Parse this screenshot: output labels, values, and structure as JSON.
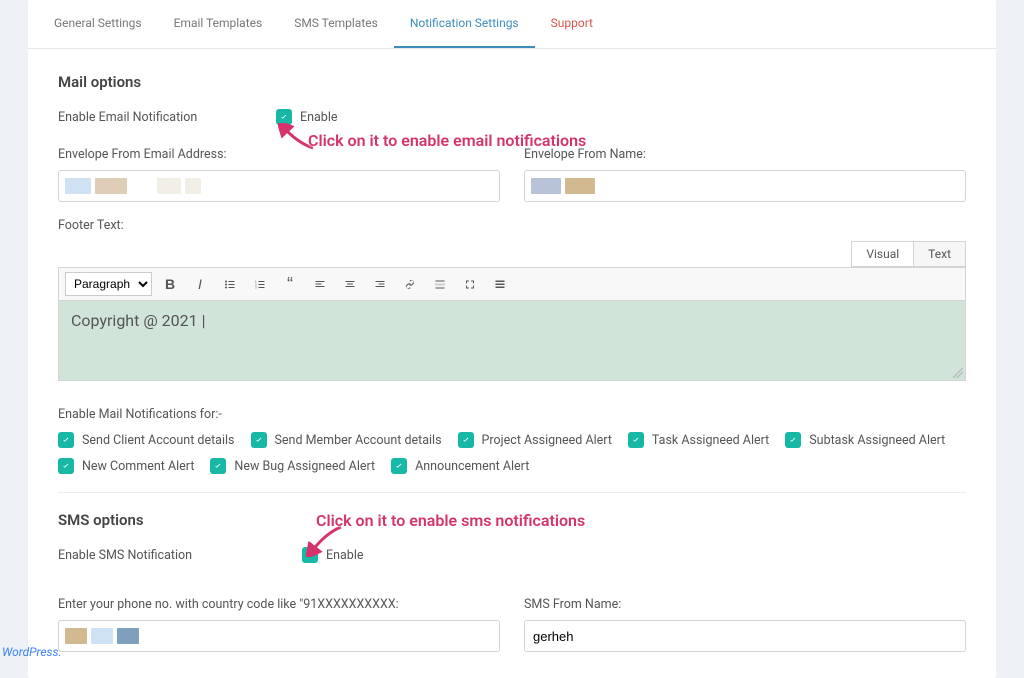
{
  "tabs": {
    "general": "General Settings",
    "email_templates": "Email Templates",
    "sms_templates": "SMS Templates",
    "notification": "Notification Settings",
    "support": "Support"
  },
  "mail": {
    "section_title": "Mail options",
    "enable_label": "Enable Email Notification",
    "enable_check": "Enable",
    "annotation": "Click on it to enable email notifications",
    "envelope_email_label": "Envelope From Email Address:",
    "envelope_name_label": "Envelope From Name:",
    "footer_label": "Footer Text:",
    "editor": {
      "tab_visual": "Visual",
      "tab_text": "Text",
      "paragraph": "Paragraph",
      "content": "Copyright @ 2021 |"
    },
    "notif_for_label": "Enable Mail Notifications for:-",
    "notif_items": [
      "Send Client Account details",
      "Send Member Account details",
      "Project Assigneed Alert",
      "Task Assigneed Alert",
      "Subtask Assigneed Alert",
      "New Comment Alert",
      "New Bug Assigneed Alert",
      "Announcement Alert"
    ]
  },
  "sms": {
    "section_title": "SMS options",
    "enable_label": "Enable SMS Notification",
    "enable_check": "Enable",
    "annotation": "Click on it to enable sms notifications",
    "phone_label": "Enter your phone no. with country code like \"91XXXXXXXXXX:",
    "from_name_label": "SMS From Name:",
    "from_name_value": "gerheh"
  },
  "footer_link": "WordPress."
}
